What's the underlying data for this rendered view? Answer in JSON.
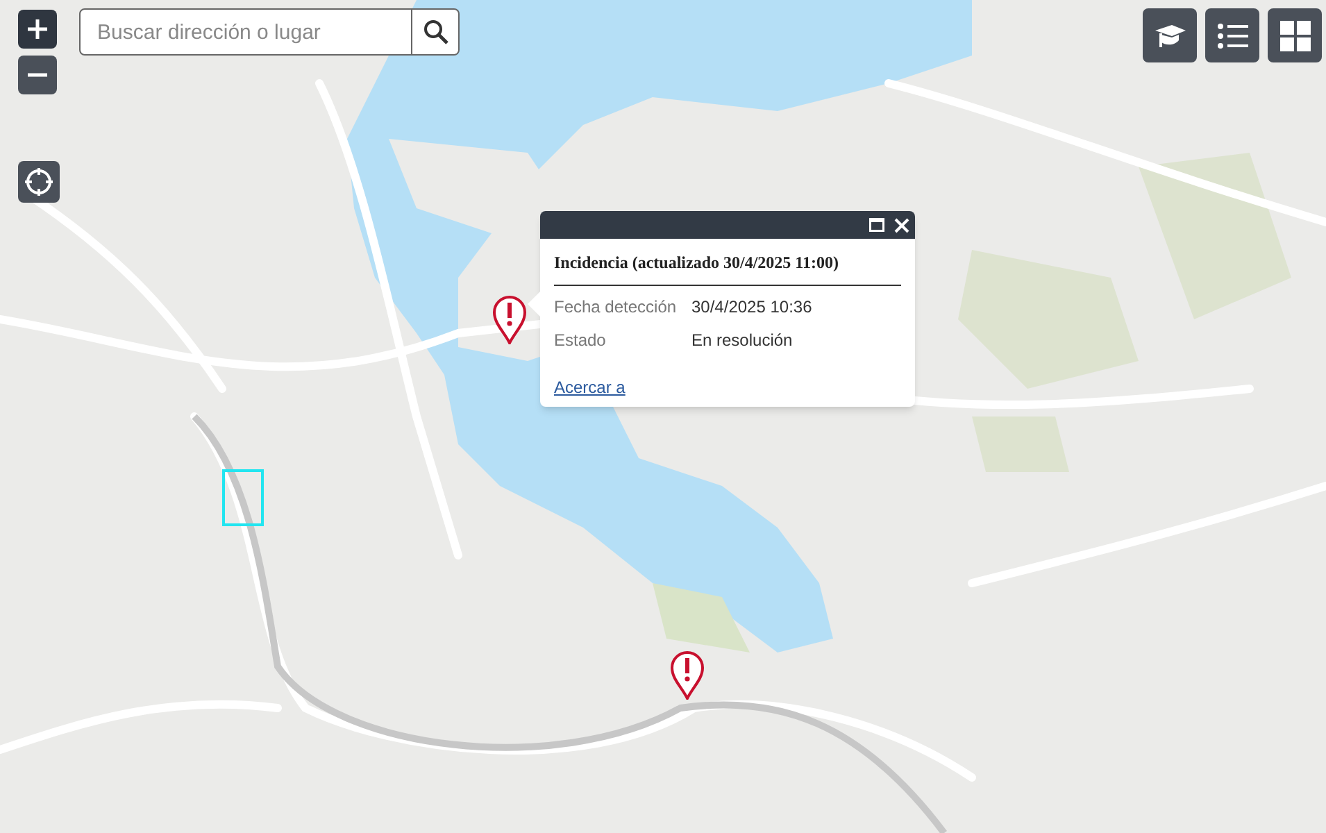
{
  "search": {
    "placeholder": "Buscar dirección o lugar"
  },
  "popup": {
    "title": "Incidencia (actualizado 30/4/2025 11:00)",
    "fields": [
      {
        "label": "Fecha detección",
        "value": "30/4/2025 10:36"
      },
      {
        "label": "Estado",
        "value": "En resolución"
      }
    ],
    "link": "Acercar a"
  }
}
